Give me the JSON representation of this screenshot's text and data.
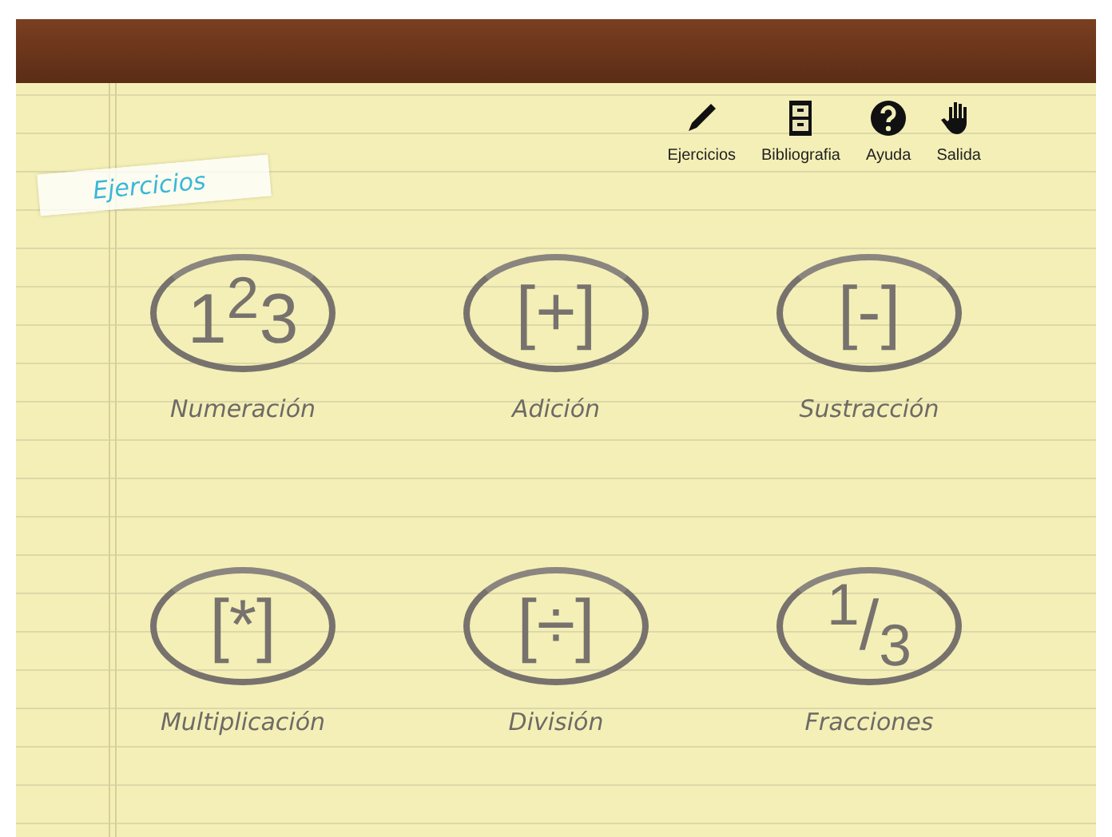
{
  "toolbar": [
    {
      "label": "Ejercicios",
      "kind": "pencil"
    },
    {
      "label": "Bibliografia",
      "kind": "cabinet"
    },
    {
      "label": "Ayuda",
      "kind": "help"
    },
    {
      "label": "Salida",
      "kind": "hand"
    }
  ],
  "section_label": "Ejercicios",
  "categories": [
    {
      "symbol": "1$^{2}$3",
      "label": "Numeración"
    },
    {
      "symbol": "[+]",
      "label": "Adición"
    },
    {
      "symbol": "[-]",
      "label": "Sustracción"
    },
    {
      "symbol": "[*]",
      "label": "Multiplicación"
    },
    {
      "symbol": "[÷]",
      "label": "División"
    },
    {
      "symbol": "$^{1}$/$_{3}$",
      "label": "Fracciones"
    }
  ]
}
